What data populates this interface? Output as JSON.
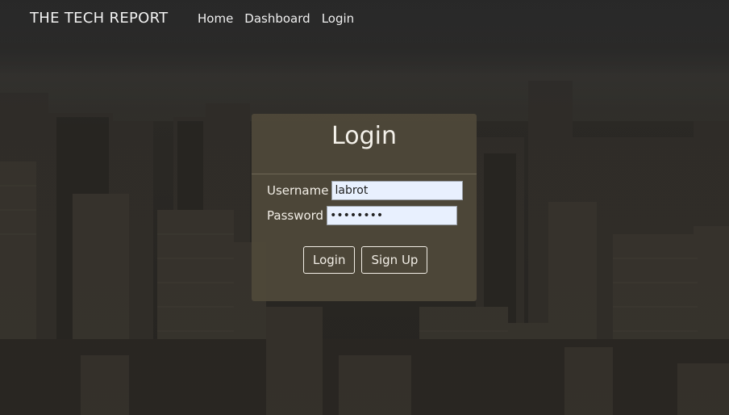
{
  "navbar": {
    "brand": "THE TECH REPORT",
    "links": [
      "Home",
      "Dashboard",
      "Login"
    ]
  },
  "login_card": {
    "title": "Login",
    "username_label": "Username",
    "username_value": "labrot",
    "password_label": "Password",
    "password_value": "12345678",
    "login_button": "Login",
    "signup_button": "Sign Up"
  },
  "colors": {
    "card_background": "#4e4839",
    "input_background": "#e8f0fe",
    "navbar_text": "#f0f0f0"
  }
}
